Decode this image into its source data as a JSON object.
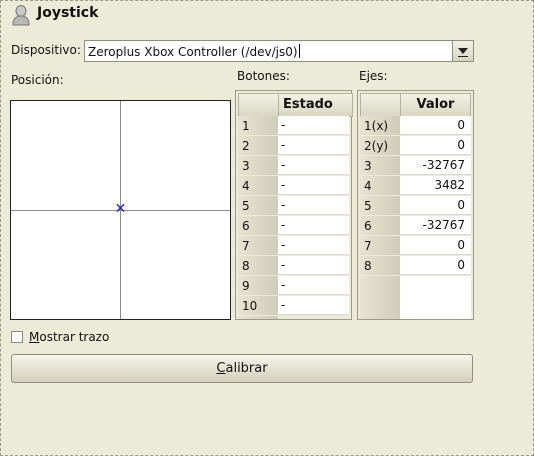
{
  "window": {
    "title": "Joystick"
  },
  "device": {
    "label": "Dispositivo:",
    "value": "Zeroplus Xbox Controller (/dev/js0)"
  },
  "position": {
    "label": "Posición:"
  },
  "buttons": {
    "label": "Botones:",
    "header": "Estado",
    "rows": [
      {
        "id": "1",
        "state": "-"
      },
      {
        "id": "2",
        "state": "-"
      },
      {
        "id": "3",
        "state": "-"
      },
      {
        "id": "4",
        "state": "-"
      },
      {
        "id": "5",
        "state": "-"
      },
      {
        "id": "6",
        "state": "-"
      },
      {
        "id": "7",
        "state": "-"
      },
      {
        "id": "8",
        "state": "-"
      },
      {
        "id": "9",
        "state": "-"
      },
      {
        "id": "10",
        "state": "-"
      }
    ]
  },
  "axes": {
    "label": "Ejes:",
    "header": "Valor",
    "rows": [
      {
        "id": "1(x)",
        "value": "0"
      },
      {
        "id": "2(y)",
        "value": "0"
      },
      {
        "id": "3",
        "value": "-32767"
      },
      {
        "id": "4",
        "value": "3482"
      },
      {
        "id": "5",
        "value": "0"
      },
      {
        "id": "6",
        "value": "-32767"
      },
      {
        "id": "7",
        "value": "0"
      },
      {
        "id": "8",
        "value": "0"
      }
    ]
  },
  "trace": {
    "label_first": "M",
    "label_rest": "ostrar trazo",
    "checked": false
  },
  "calibrate": {
    "label_first": "C",
    "label_rest": "alibrar"
  },
  "colors": {
    "background": "#ecebd8",
    "marker": "#1a1acc"
  },
  "icons": {
    "title": "joystick-user-icon",
    "combo": "chevron-down-icon"
  }
}
